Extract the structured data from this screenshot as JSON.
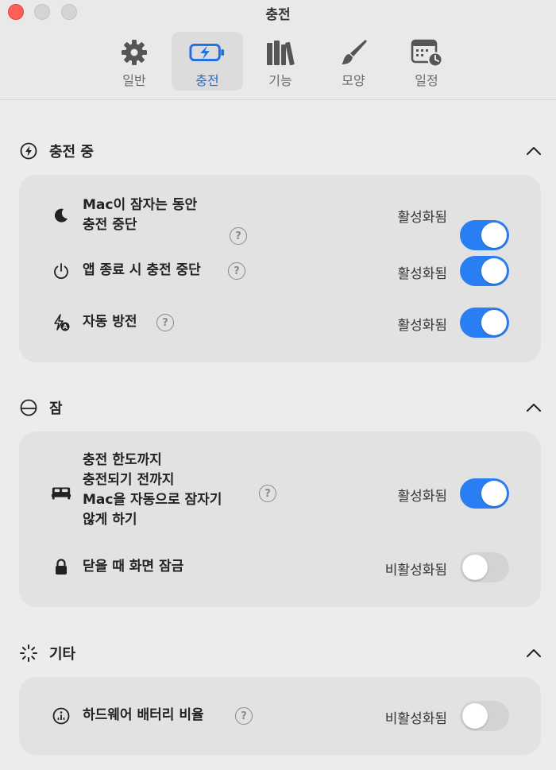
{
  "window": {
    "title": "충전"
  },
  "tabs": [
    {
      "label": "일반",
      "icon": "gear-icon"
    },
    {
      "label": "충전",
      "icon": "battery-charging-icon",
      "active": true
    },
    {
      "label": "기능",
      "icon": "books-icon"
    },
    {
      "label": "모양",
      "icon": "paintbrush-icon"
    },
    {
      "label": "일정",
      "icon": "calendar-clock-icon"
    }
  ],
  "sections": {
    "charging": {
      "title": "충전 중",
      "rows": [
        {
          "label_line1": "Mac이 잠자는 동안",
          "label_line2": "충전 중단",
          "status": "활성화됨",
          "on": true,
          "icon": "moon-icon"
        },
        {
          "label": "앱 종료 시 충전 중단",
          "status": "활성화됨",
          "on": true,
          "icon": "power-icon"
        },
        {
          "label": "자동 방전",
          "status": "활성화됨",
          "on": true,
          "icon": "auto-discharge-icon"
        }
      ]
    },
    "sleep": {
      "title": "잠",
      "rows": [
        {
          "line1": "충전 한도까지",
          "line2": "충전되기 전까지",
          "line3": "Mac을 자동으로 잠자기",
          "line4": "않게 하기",
          "status": "활성화됨",
          "on": true,
          "icon": "bed-icon"
        },
        {
          "label": "닫을 때 화면 잠금",
          "status": "비활성화됨",
          "on": false,
          "icon": "lock-icon"
        }
      ]
    },
    "other": {
      "title": "기타",
      "rows": [
        {
          "label": "하드웨어 배터리 비율",
          "status": "비활성화됨",
          "on": false,
          "icon": "info-circle-icon"
        }
      ]
    }
  },
  "help_symbol": "?",
  "colors": {
    "accent": "#2a7ef4",
    "toggle_off": "#d3d3d3",
    "close": "#fe5f57"
  }
}
